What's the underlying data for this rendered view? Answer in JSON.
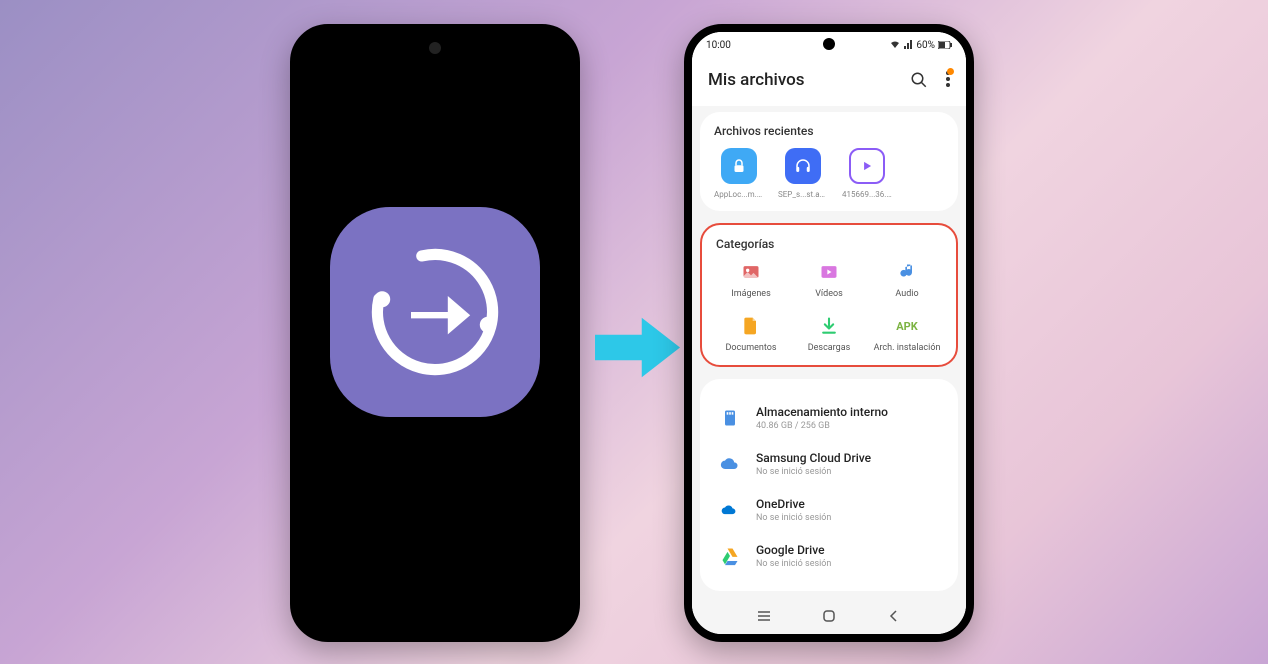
{
  "statusbar": {
    "time": "10:00",
    "battery": "60%"
  },
  "header": {
    "title": "Mis archivos"
  },
  "recent": {
    "title": "Archivos recientes",
    "items": [
      {
        "label": "AppLoc...m.apk",
        "bg": "#3fa9f5",
        "glyph": "lock"
      },
      {
        "label": "SEP_s...st.apk",
        "bg": "#3f6df5",
        "glyph": "headphones"
      },
      {
        "label": "415669...36.avi",
        "bg": "#8b5cf6",
        "glyph": "play"
      }
    ]
  },
  "categories": {
    "title": "Categorías",
    "items": [
      {
        "label": "Imágenes",
        "color": "#e06666",
        "glyph": "image"
      },
      {
        "label": "Vídeos",
        "color": "#d977e0",
        "glyph": "video"
      },
      {
        "label": "Audio",
        "color": "#4a90e2",
        "glyph": "audio"
      },
      {
        "label": "Documentos",
        "color": "#f5a623",
        "glyph": "doc"
      },
      {
        "label": "Descargas",
        "color": "#2ecc71",
        "glyph": "download"
      },
      {
        "label": "Arch. instalación",
        "color": "#7cb342",
        "glyph": "apk"
      }
    ]
  },
  "storage": {
    "items": [
      {
        "title": "Almacenamiento interno",
        "sub": "40.86 GB / 256 GB",
        "color": "#4a90e2",
        "glyph": "sd"
      },
      {
        "title": "Samsung Cloud Drive",
        "sub": "No se inició sesión",
        "color": "#4a90e2",
        "glyph": "cloud"
      },
      {
        "title": "OneDrive",
        "sub": "No se inició sesión",
        "color": "#0078d4",
        "glyph": "onedrive"
      },
      {
        "title": "Google Drive",
        "sub": "No se inició sesión",
        "color": "#f5a623",
        "glyph": "gdrive"
      }
    ]
  }
}
